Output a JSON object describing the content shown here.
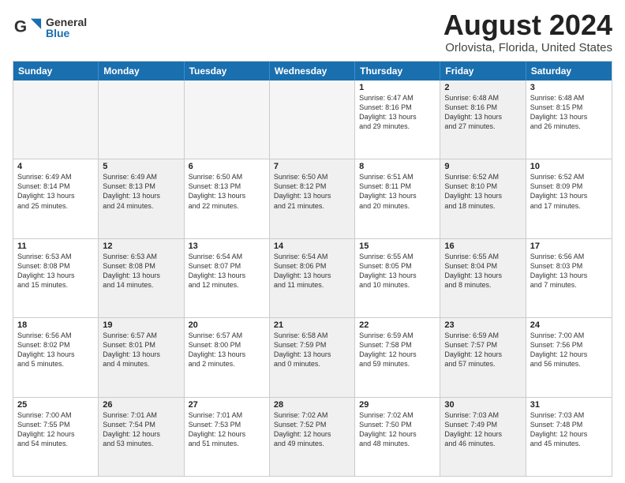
{
  "logo": {
    "general": "General",
    "blue": "Blue"
  },
  "title": "August 2024",
  "subtitle": "Orlovista, Florida, United States",
  "headers": [
    "Sunday",
    "Monday",
    "Tuesday",
    "Wednesday",
    "Thursday",
    "Friday",
    "Saturday"
  ],
  "rows": [
    [
      {
        "day": "",
        "text": "",
        "empty": true
      },
      {
        "day": "",
        "text": "",
        "empty": true
      },
      {
        "day": "",
        "text": "",
        "empty": true
      },
      {
        "day": "",
        "text": "",
        "empty": true
      },
      {
        "day": "1",
        "text": "Sunrise: 6:47 AM\nSunset: 8:16 PM\nDaylight: 13 hours\nand 29 minutes.",
        "empty": false,
        "shaded": false
      },
      {
        "day": "2",
        "text": "Sunrise: 6:48 AM\nSunset: 8:16 PM\nDaylight: 13 hours\nand 27 minutes.",
        "empty": false,
        "shaded": true
      },
      {
        "day": "3",
        "text": "Sunrise: 6:48 AM\nSunset: 8:15 PM\nDaylight: 13 hours\nand 26 minutes.",
        "empty": false,
        "shaded": false
      }
    ],
    [
      {
        "day": "4",
        "text": "Sunrise: 6:49 AM\nSunset: 8:14 PM\nDaylight: 13 hours\nand 25 minutes.",
        "empty": false,
        "shaded": false
      },
      {
        "day": "5",
        "text": "Sunrise: 6:49 AM\nSunset: 8:13 PM\nDaylight: 13 hours\nand 24 minutes.",
        "empty": false,
        "shaded": true
      },
      {
        "day": "6",
        "text": "Sunrise: 6:50 AM\nSunset: 8:13 PM\nDaylight: 13 hours\nand 22 minutes.",
        "empty": false,
        "shaded": false
      },
      {
        "day": "7",
        "text": "Sunrise: 6:50 AM\nSunset: 8:12 PM\nDaylight: 13 hours\nand 21 minutes.",
        "empty": false,
        "shaded": true
      },
      {
        "day": "8",
        "text": "Sunrise: 6:51 AM\nSunset: 8:11 PM\nDaylight: 13 hours\nand 20 minutes.",
        "empty": false,
        "shaded": false
      },
      {
        "day": "9",
        "text": "Sunrise: 6:52 AM\nSunset: 8:10 PM\nDaylight: 13 hours\nand 18 minutes.",
        "empty": false,
        "shaded": true
      },
      {
        "day": "10",
        "text": "Sunrise: 6:52 AM\nSunset: 8:09 PM\nDaylight: 13 hours\nand 17 minutes.",
        "empty": false,
        "shaded": false
      }
    ],
    [
      {
        "day": "11",
        "text": "Sunrise: 6:53 AM\nSunset: 8:08 PM\nDaylight: 13 hours\nand 15 minutes.",
        "empty": false,
        "shaded": false
      },
      {
        "day": "12",
        "text": "Sunrise: 6:53 AM\nSunset: 8:08 PM\nDaylight: 13 hours\nand 14 minutes.",
        "empty": false,
        "shaded": true
      },
      {
        "day": "13",
        "text": "Sunrise: 6:54 AM\nSunset: 8:07 PM\nDaylight: 13 hours\nand 12 minutes.",
        "empty": false,
        "shaded": false
      },
      {
        "day": "14",
        "text": "Sunrise: 6:54 AM\nSunset: 8:06 PM\nDaylight: 13 hours\nand 11 minutes.",
        "empty": false,
        "shaded": true
      },
      {
        "day": "15",
        "text": "Sunrise: 6:55 AM\nSunset: 8:05 PM\nDaylight: 13 hours\nand 10 minutes.",
        "empty": false,
        "shaded": false
      },
      {
        "day": "16",
        "text": "Sunrise: 6:55 AM\nSunset: 8:04 PM\nDaylight: 13 hours\nand 8 minutes.",
        "empty": false,
        "shaded": true
      },
      {
        "day": "17",
        "text": "Sunrise: 6:56 AM\nSunset: 8:03 PM\nDaylight: 13 hours\nand 7 minutes.",
        "empty": false,
        "shaded": false
      }
    ],
    [
      {
        "day": "18",
        "text": "Sunrise: 6:56 AM\nSunset: 8:02 PM\nDaylight: 13 hours\nand 5 minutes.",
        "empty": false,
        "shaded": false
      },
      {
        "day": "19",
        "text": "Sunrise: 6:57 AM\nSunset: 8:01 PM\nDaylight: 13 hours\nand 4 minutes.",
        "empty": false,
        "shaded": true
      },
      {
        "day": "20",
        "text": "Sunrise: 6:57 AM\nSunset: 8:00 PM\nDaylight: 13 hours\nand 2 minutes.",
        "empty": false,
        "shaded": false
      },
      {
        "day": "21",
        "text": "Sunrise: 6:58 AM\nSunset: 7:59 PM\nDaylight: 13 hours\nand 0 minutes.",
        "empty": false,
        "shaded": true
      },
      {
        "day": "22",
        "text": "Sunrise: 6:59 AM\nSunset: 7:58 PM\nDaylight: 12 hours\nand 59 minutes.",
        "empty": false,
        "shaded": false
      },
      {
        "day": "23",
        "text": "Sunrise: 6:59 AM\nSunset: 7:57 PM\nDaylight: 12 hours\nand 57 minutes.",
        "empty": false,
        "shaded": true
      },
      {
        "day": "24",
        "text": "Sunrise: 7:00 AM\nSunset: 7:56 PM\nDaylight: 12 hours\nand 56 minutes.",
        "empty": false,
        "shaded": false
      }
    ],
    [
      {
        "day": "25",
        "text": "Sunrise: 7:00 AM\nSunset: 7:55 PM\nDaylight: 12 hours\nand 54 minutes.",
        "empty": false,
        "shaded": false
      },
      {
        "day": "26",
        "text": "Sunrise: 7:01 AM\nSunset: 7:54 PM\nDaylight: 12 hours\nand 53 minutes.",
        "empty": false,
        "shaded": true
      },
      {
        "day": "27",
        "text": "Sunrise: 7:01 AM\nSunset: 7:53 PM\nDaylight: 12 hours\nand 51 minutes.",
        "empty": false,
        "shaded": false
      },
      {
        "day": "28",
        "text": "Sunrise: 7:02 AM\nSunset: 7:52 PM\nDaylight: 12 hours\nand 49 minutes.",
        "empty": false,
        "shaded": true
      },
      {
        "day": "29",
        "text": "Sunrise: 7:02 AM\nSunset: 7:50 PM\nDaylight: 12 hours\nand 48 minutes.",
        "empty": false,
        "shaded": false
      },
      {
        "day": "30",
        "text": "Sunrise: 7:03 AM\nSunset: 7:49 PM\nDaylight: 12 hours\nand 46 minutes.",
        "empty": false,
        "shaded": true
      },
      {
        "day": "31",
        "text": "Sunrise: 7:03 AM\nSunset: 7:48 PM\nDaylight: 12 hours\nand 45 minutes.",
        "empty": false,
        "shaded": false
      }
    ]
  ]
}
